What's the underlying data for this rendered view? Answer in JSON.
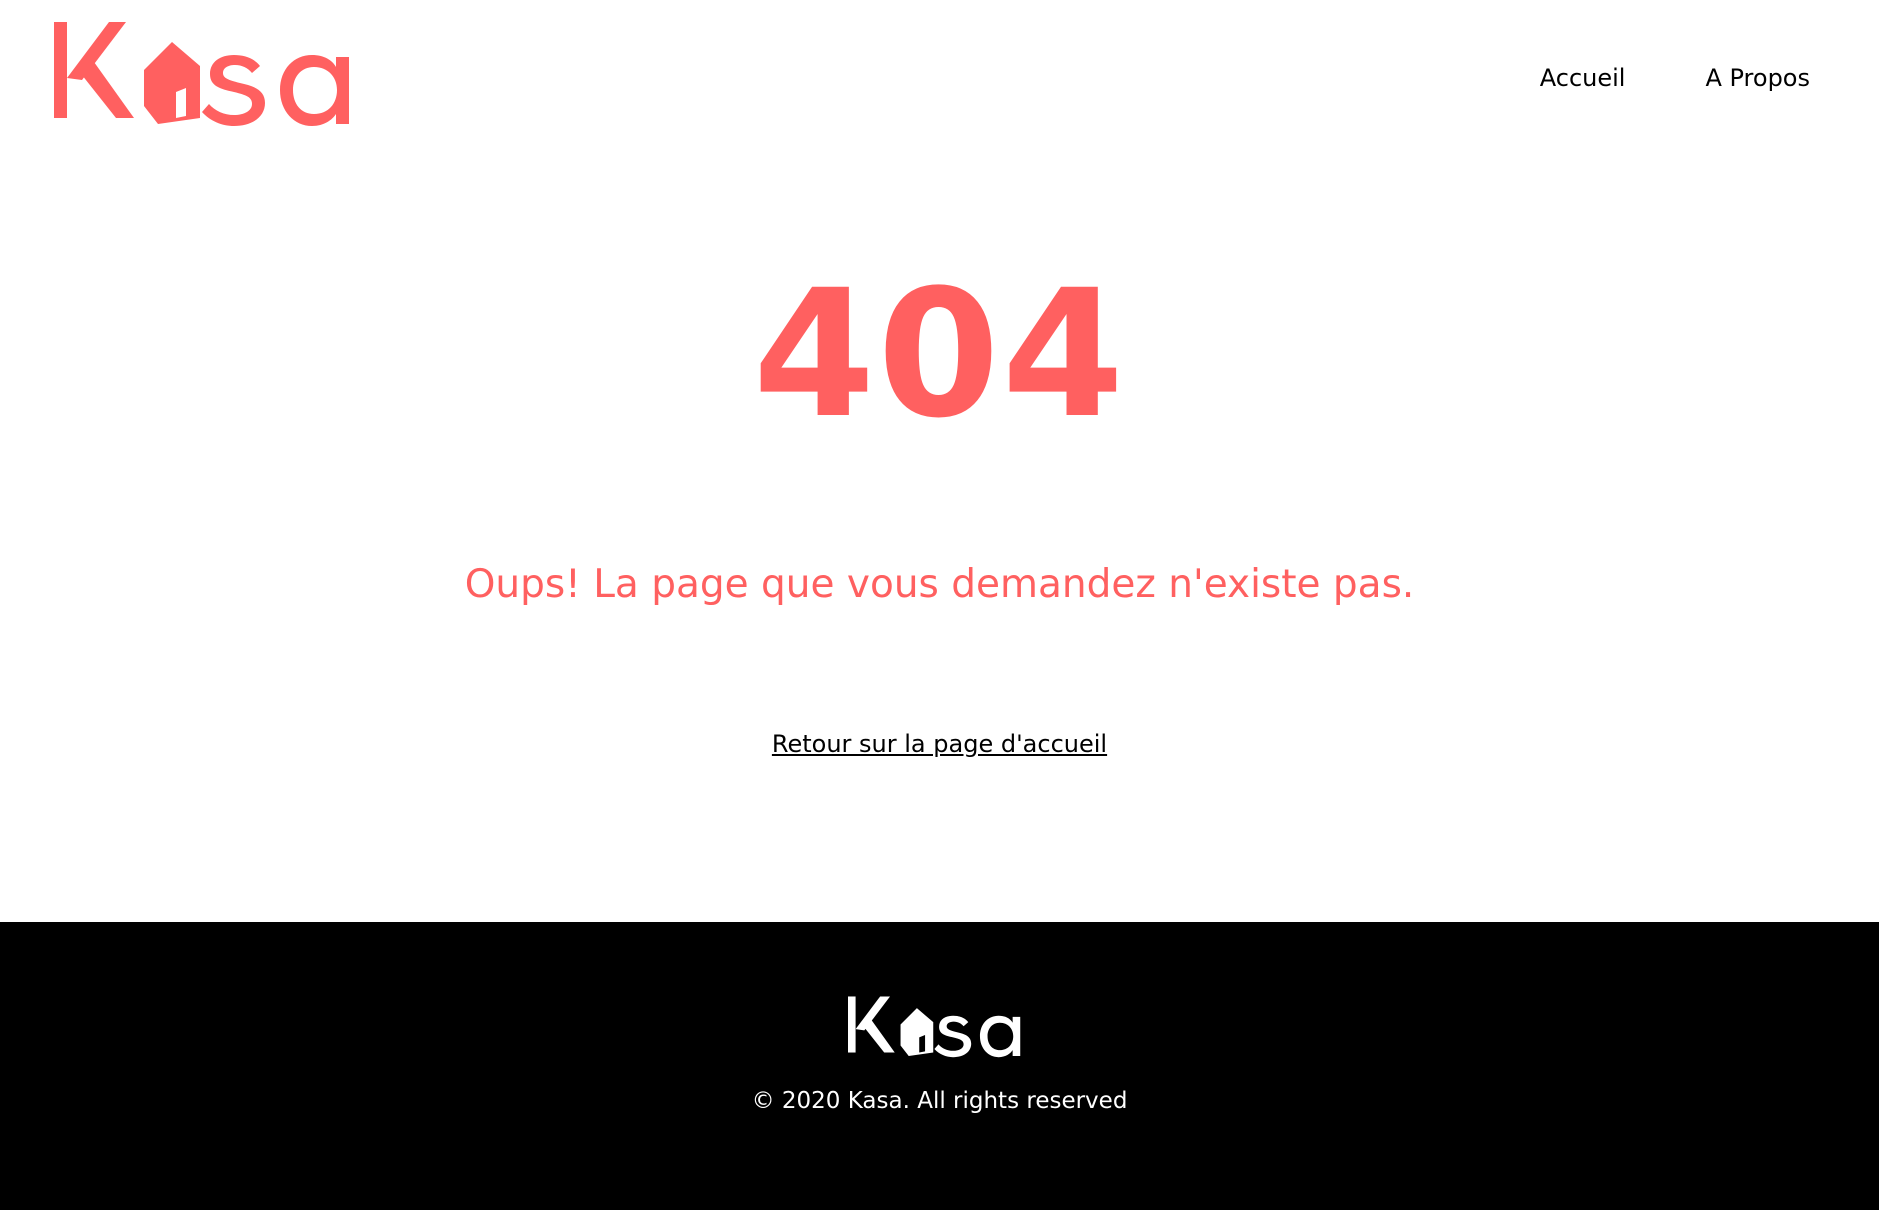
{
  "colors": {
    "brand": "#FF6060",
    "text": "#000000",
    "background": "#FFFFFF",
    "footer_background": "#000000",
    "footer_text": "#FFFFFF"
  },
  "header": {
    "logo_text": "Kasa",
    "nav": [
      {
        "label": "Accueil"
      },
      {
        "label": "A Propos"
      }
    ]
  },
  "main": {
    "error_code": "404",
    "message": "Oups! La page que vous demandez n'existe pas.",
    "home_link": "Retour sur la page d'accueil"
  },
  "footer": {
    "logo_text": "Kasa",
    "copyright": "© 2020 Kasa. All rights reserved"
  }
}
